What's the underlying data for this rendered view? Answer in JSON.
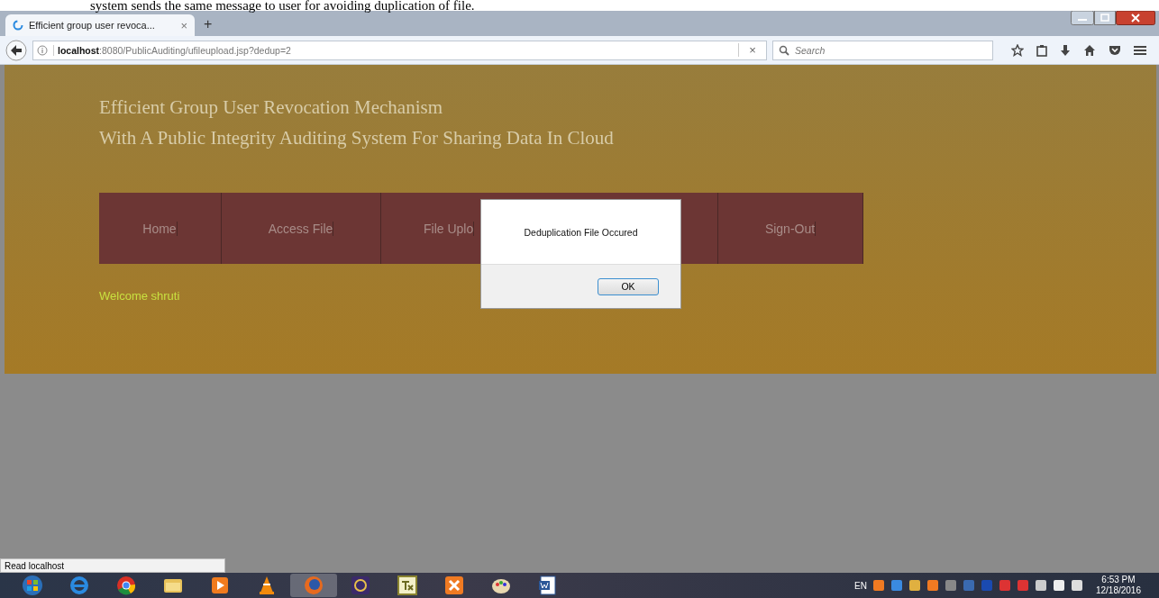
{
  "document_text": "system sends the same message to user for avoiding duplication of file.",
  "browser": {
    "tabs": [
      {
        "title": "Efficient group user revoca...",
        "selected": true,
        "close": "×"
      }
    ],
    "new_tab": "+",
    "address": "**localhost**:8080/PublicAuditing/ufileupload.jsp?dedup=2",
    "clear": "×",
    "search": {
      "placeholder": "Search"
    }
  },
  "page": {
    "title_lines": [
      "Efficient Group User Revocation Mechanism",
      "With A Public Integrity Auditing System For Sharing Data In Cloud"
    ],
    "nav": [
      {
        "label": "Home"
      },
      {
        "label": "Access File"
      },
      {
        "label": "File Uplo"
      },
      {
        "label": "Sign-Out"
      }
    ],
    "welcome": "Welcome shruti"
  },
  "dialog": {
    "message": "Deduplication File Occured",
    "button": "OK"
  },
  "status_bar": "Read localhost",
  "taskbar": {
    "apps": [
      {
        "kind": "windows",
        "selected": false
      },
      {
        "kind": "ie",
        "selected": false
      },
      {
        "kind": "chrome",
        "selected": false
      },
      {
        "kind": "folder",
        "selected": false
      },
      {
        "kind": "media",
        "selected": false
      },
      {
        "kind": "vlc",
        "selected": false
      },
      {
        "kind": "firefox",
        "selected": true
      },
      {
        "kind": "java",
        "selected": false
      },
      {
        "kind": "txc",
        "selected": false
      },
      {
        "kind": "xampp",
        "selected": false
      },
      {
        "kind": "paint",
        "selected": false
      },
      {
        "kind": "word",
        "selected": false
      }
    ],
    "language": "EN",
    "time": "6:53 PM",
    "date": "12/18/2016"
  }
}
